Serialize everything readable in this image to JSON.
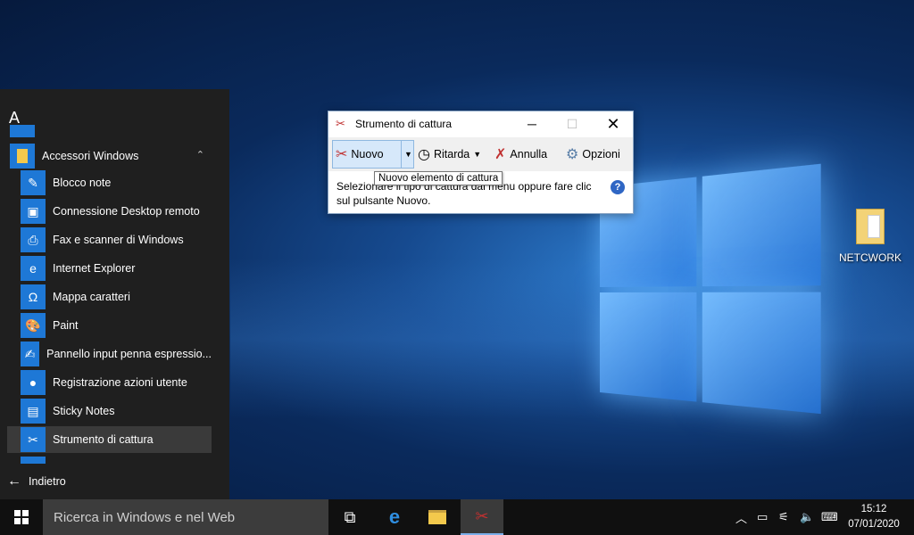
{
  "desktop": {
    "icon_label": "NETCWORK"
  },
  "start_menu": {
    "letter": "A",
    "folder": "Accessori Windows",
    "items": [
      {
        "label": "Blocco note",
        "icon": "notepad-icon"
      },
      {
        "label": "Connessione Desktop remoto",
        "icon": "remote-desktop-icon"
      },
      {
        "label": "Fax e scanner di Windows",
        "icon": "fax-scanner-icon"
      },
      {
        "label": "Internet Explorer",
        "icon": "internet-explorer-icon"
      },
      {
        "label": "Mappa caratteri",
        "icon": "character-map-icon"
      },
      {
        "label": "Paint",
        "icon": "paint-icon"
      },
      {
        "label": "Pannello input penna espressio...",
        "icon": "math-input-icon"
      },
      {
        "label": "Registrazione azioni utente",
        "icon": "steps-recorder-icon"
      },
      {
        "label": "Sticky Notes",
        "icon": "sticky-notes-icon"
      },
      {
        "label": "Strumento di cattura",
        "icon": "snipping-tool-icon"
      }
    ],
    "back_label": "Indietro"
  },
  "snipping_tool": {
    "title": "Strumento di cattura",
    "buttons": {
      "new": "Nuovo",
      "delay": "Ritarda",
      "cancel": "Annulla",
      "options": "Opzioni"
    },
    "help_text": "Selezionare il tipo di cattura dal menu oppure fare clic sul pulsante Nuovo.",
    "tooltip": "Nuovo elemento di cattura"
  },
  "taskbar": {
    "search_placeholder": "Ricerca in Windows e nel Web",
    "time": "15:12",
    "date": "07/01/2020"
  },
  "colors": {
    "accent": "#1e78d6",
    "start_menu_bg": "#1f1f1f",
    "taskbar_bg": "#101010"
  }
}
